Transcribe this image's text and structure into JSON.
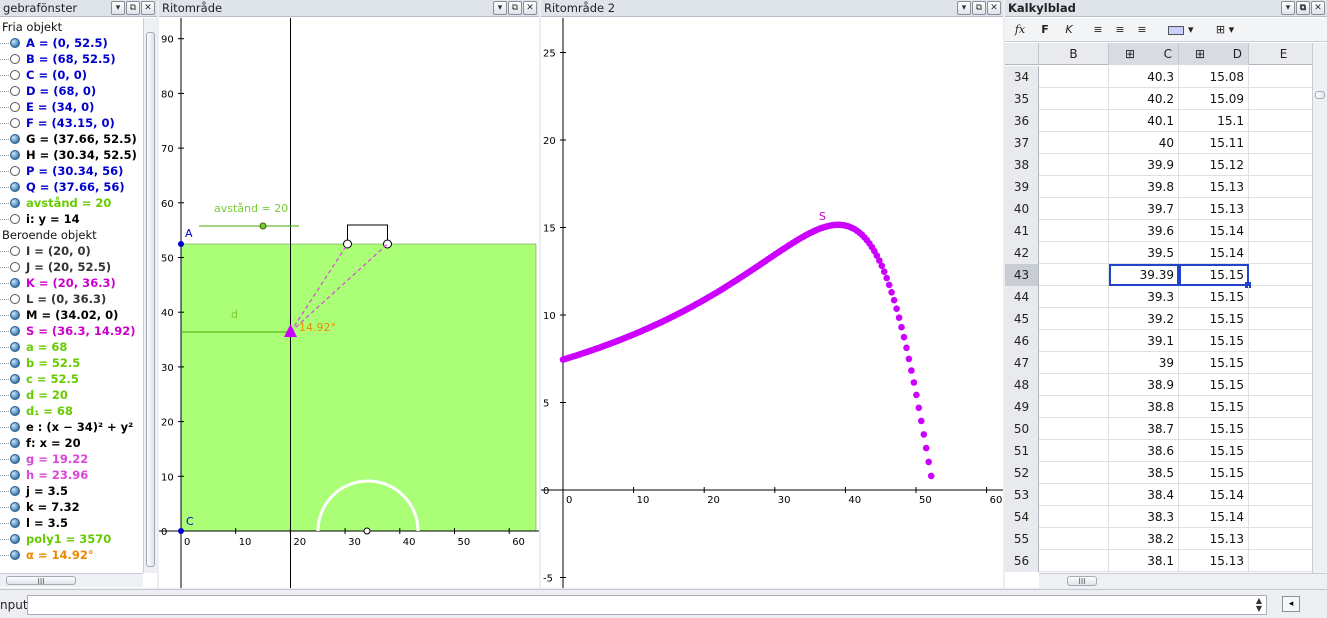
{
  "algebra": {
    "title": "gebrafönster",
    "free_heading": "Fria objekt",
    "dependent_heading": "Beroende objekt",
    "free": [
      {
        "text": "A = (0, 52.5)",
        "color": "#0000cc",
        "dot": "filled"
      },
      {
        "text": "B = (68, 52.5)",
        "color": "#0000cc",
        "dot": "empty"
      },
      {
        "text": "C = (0, 0)",
        "color": "#0000cc",
        "dot": "empty"
      },
      {
        "text": "D = (68, 0)",
        "color": "#0000cc",
        "dot": "empty"
      },
      {
        "text": "E = (34, 0)",
        "color": "#0000cc",
        "dot": "empty"
      },
      {
        "text": "F = (43.15, 0)",
        "color": "#0000cc",
        "dot": "empty"
      },
      {
        "text": "G = (37.66, 52.5)",
        "color": "#000000",
        "dot": "filled"
      },
      {
        "text": "H = (30.34, 52.5)",
        "color": "#000000",
        "dot": "filled"
      },
      {
        "text": "P = (30.34, 56)",
        "color": "#0000cc",
        "dot": "empty"
      },
      {
        "text": "Q = (37.66, 56)",
        "color": "#0000cc",
        "dot": "filled"
      },
      {
        "text": "avstånd = 20",
        "color": "#66cc00",
        "dot": "filled"
      },
      {
        "text": "i: y = 14",
        "color": "#000000",
        "dot": "empty"
      }
    ],
    "dependent": [
      {
        "text": "I = (20, 0)",
        "color": "#333333",
        "dot": "empty"
      },
      {
        "text": "J = (20, 52.5)",
        "color": "#333333",
        "dot": "empty"
      },
      {
        "text": "K = (20, 36.3)",
        "color": "#cc00cc",
        "dot": "filled"
      },
      {
        "text": "L = (0, 36.3)",
        "color": "#333333",
        "dot": "empty"
      },
      {
        "text": "M = (34.02, 0)",
        "color": "#000000",
        "dot": "filled"
      },
      {
        "text": "S = (36.3, 14.92)",
        "color": "#cc00cc",
        "dot": "filled"
      },
      {
        "text": "a = 68",
        "color": "#66cc00",
        "dot": "filled"
      },
      {
        "text": "b = 52.5",
        "color": "#66cc00",
        "dot": "filled"
      },
      {
        "text": "c = 52.5",
        "color": "#66cc00",
        "dot": "filled"
      },
      {
        "text": "d = 20",
        "color": "#66cc00",
        "dot": "filled"
      },
      {
        "text": "d₁ = 68",
        "color": "#66cc00",
        "dot": "filled"
      },
      {
        "text": "e : (x − 34)² + y²",
        "color": "#000000",
        "dot": "filled"
      },
      {
        "text": "f: x = 20",
        "color": "#000000",
        "dot": "filled"
      },
      {
        "text": "g = 19.22",
        "color": "#dd44dd",
        "dot": "filled"
      },
      {
        "text": "h = 23.96",
        "color": "#dd44dd",
        "dot": "filled"
      },
      {
        "text": "j = 3.5",
        "color": "#000000",
        "dot": "filled"
      },
      {
        "text": "k = 7.32",
        "color": "#000000",
        "dot": "filled"
      },
      {
        "text": "l = 3.5",
        "color": "#000000",
        "dot": "filled"
      },
      {
        "text": "poly1 = 3570",
        "color": "#66cc00",
        "dot": "filled"
      },
      {
        "text": "α = 14.92°",
        "color": "#ee8800",
        "dot": "filled"
      }
    ]
  },
  "graphics1": {
    "title": "Ritområde",
    "label_A": "A",
    "label_C": "C",
    "slider_label": "avstånd = 20",
    "label_d": "d",
    "angle_label": "14.92°",
    "x_ticks": [
      "0",
      "10",
      "20",
      "30",
      "40",
      "50",
      "60"
    ],
    "y_ticks": [
      "0",
      "10",
      "20",
      "30",
      "40",
      "50",
      "60",
      "70",
      "80",
      "90"
    ]
  },
  "graphics2": {
    "title": "Ritområde 2",
    "point_label": "S",
    "x_ticks": [
      "0",
      "10",
      "20",
      "30",
      "40",
      "50",
      "60"
    ],
    "y_ticks": [
      "-5",
      "0",
      "5",
      "10",
      "15",
      "20",
      "25"
    ]
  },
  "spreadsheet": {
    "title": "Kalkylblad",
    "toolbar": {
      "fx": "fx",
      "bold": "F",
      "italic": "K"
    },
    "columns": [
      "B",
      "C",
      "D",
      "E"
    ],
    "rows": [
      {
        "n": "34",
        "c": "40.3",
        "d": "15.08"
      },
      {
        "n": "35",
        "c": "40.2",
        "d": "15.09"
      },
      {
        "n": "36",
        "c": "40.1",
        "d": "15.1"
      },
      {
        "n": "37",
        "c": "40",
        "d": "15.11"
      },
      {
        "n": "38",
        "c": "39.9",
        "d": "15.12"
      },
      {
        "n": "39",
        "c": "39.8",
        "d": "15.13"
      },
      {
        "n": "40",
        "c": "39.7",
        "d": "15.13"
      },
      {
        "n": "41",
        "c": "39.6",
        "d": "15.14"
      },
      {
        "n": "42",
        "c": "39.5",
        "d": "15.14"
      },
      {
        "n": "43",
        "c": "39.39",
        "d": "15.15"
      },
      {
        "n": "44",
        "c": "39.3",
        "d": "15.15"
      },
      {
        "n": "45",
        "c": "39.2",
        "d": "15.15"
      },
      {
        "n": "46",
        "c": "39.1",
        "d": "15.15"
      },
      {
        "n": "47",
        "c": "39",
        "d": "15.15"
      },
      {
        "n": "48",
        "c": "38.9",
        "d": "15.15"
      },
      {
        "n": "49",
        "c": "38.8",
        "d": "15.15"
      },
      {
        "n": "50",
        "c": "38.7",
        "d": "15.15"
      },
      {
        "n": "51",
        "c": "38.6",
        "d": "15.15"
      },
      {
        "n": "52",
        "c": "38.5",
        "d": "15.15"
      },
      {
        "n": "53",
        "c": "38.4",
        "d": "15.14"
      },
      {
        "n": "54",
        "c": "38.3",
        "d": "15.14"
      },
      {
        "n": "55",
        "c": "38.2",
        "d": "15.13"
      },
      {
        "n": "56",
        "c": "38.1",
        "d": "15.13"
      }
    ],
    "selected_row": "43"
  },
  "input_bar": {
    "label": "nput:",
    "value": ""
  },
  "colors": {
    "field_green": "#aaff77",
    "magenta": "#cc00ff",
    "selection": "#2244cc"
  }
}
